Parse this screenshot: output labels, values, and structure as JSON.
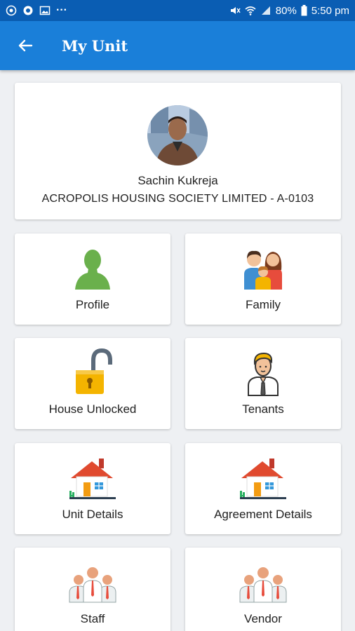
{
  "status_bar": {
    "battery": "80%",
    "time": "5:50 pm",
    "dots": "···",
    "left_icons": [
      "whatsapp-icon",
      "chat-icon",
      "image-icon"
    ],
    "right_icons": [
      "mute-icon",
      "wifi-icon",
      "signal-icon",
      "battery-icon"
    ]
  },
  "app_bar": {
    "title": "My Unit",
    "back_icon": "arrow-left-icon"
  },
  "profile": {
    "name": "Sachin Kukreja",
    "society": "ACROPOLIS HOUSING SOCIETY LIMITED - A-0103"
  },
  "tiles": [
    {
      "label": "Profile",
      "icon": "person-icon"
    },
    {
      "label": "Family",
      "icon": "family-icon"
    },
    {
      "label": "House Unlocked",
      "icon": "padlock-open-icon"
    },
    {
      "label": "Tenants",
      "icon": "tenant-icon"
    },
    {
      "label": "Unit Details",
      "icon": "house-icon"
    },
    {
      "label": "Agreement Details",
      "icon": "house-icon"
    },
    {
      "label": "Staff",
      "icon": "staff-group-icon"
    },
    {
      "label": "Vendor",
      "icon": "vendor-group-icon"
    }
  ],
  "colors": {
    "status_bar": "#0a5db3",
    "app_bar": "#1a7fd9",
    "background": "#eef0f3"
  }
}
